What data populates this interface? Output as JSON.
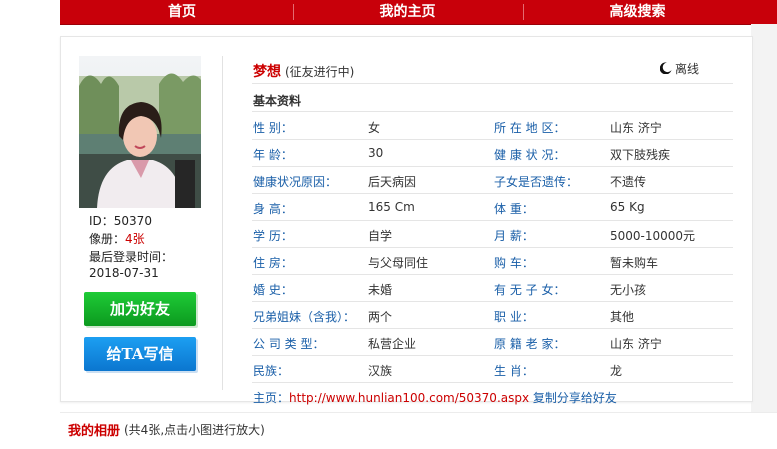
{
  "nav": [
    "首页",
    "我的主页",
    "高级搜索"
  ],
  "profile": {
    "name": "梦想",
    "status": "(征友进行中)",
    "online": "离线",
    "id_label": "ID：",
    "id": "50370",
    "album_label": "像册：",
    "album_count": "4张",
    "last_login_label": "最后登录时间：",
    "last_login": "2018-07-31",
    "add_friend": "加为好友",
    "write_letter": "给TA写信"
  },
  "basic": {
    "title": "基本资料",
    "rows": [
      [
        "性  别：",
        "女",
        "所 在 地 区：",
        "山东 济宁"
      ],
      [
        "年  龄：",
        "30",
        "健 康 状 况：",
        "双下肢残疾"
      ],
      [
        "健康状况原因：",
        "后天病因",
        "子女是否遗传：",
        "不遗传"
      ],
      [
        "身  高：",
        "165 Cm",
        "体  重：",
        "65 Kg"
      ],
      [
        "学  历：",
        "自学",
        "月  薪：",
        "5000-10000元"
      ],
      [
        "住  房：",
        "与父母同住",
        "购  车：",
        "暂未购车"
      ],
      [
        "婚  史：",
        "未婚",
        "有 无 子 女：",
        "无小孩"
      ],
      [
        "兄弟姐妹（含我）：",
        "两个",
        "职  业：",
        "其他"
      ],
      [
        "公 司 类 型：",
        "私营企业",
        "原 籍 老 家：",
        "山东 济宁"
      ],
      [
        "民族：",
        "汉族",
        "生  肖：",
        "龙"
      ]
    ]
  },
  "homepage": {
    "label": "主页：",
    "url": "http://www.hunlian100.com/50370.aspx",
    "share": "复制分享给好友"
  },
  "album": {
    "title": "我的相册",
    "subtitle": "(共4张,点击小图进行放大)"
  },
  "colors": {
    "nav_bg": "#c8000a",
    "label": "#1a5fa8",
    "accent": "#cc0000"
  }
}
